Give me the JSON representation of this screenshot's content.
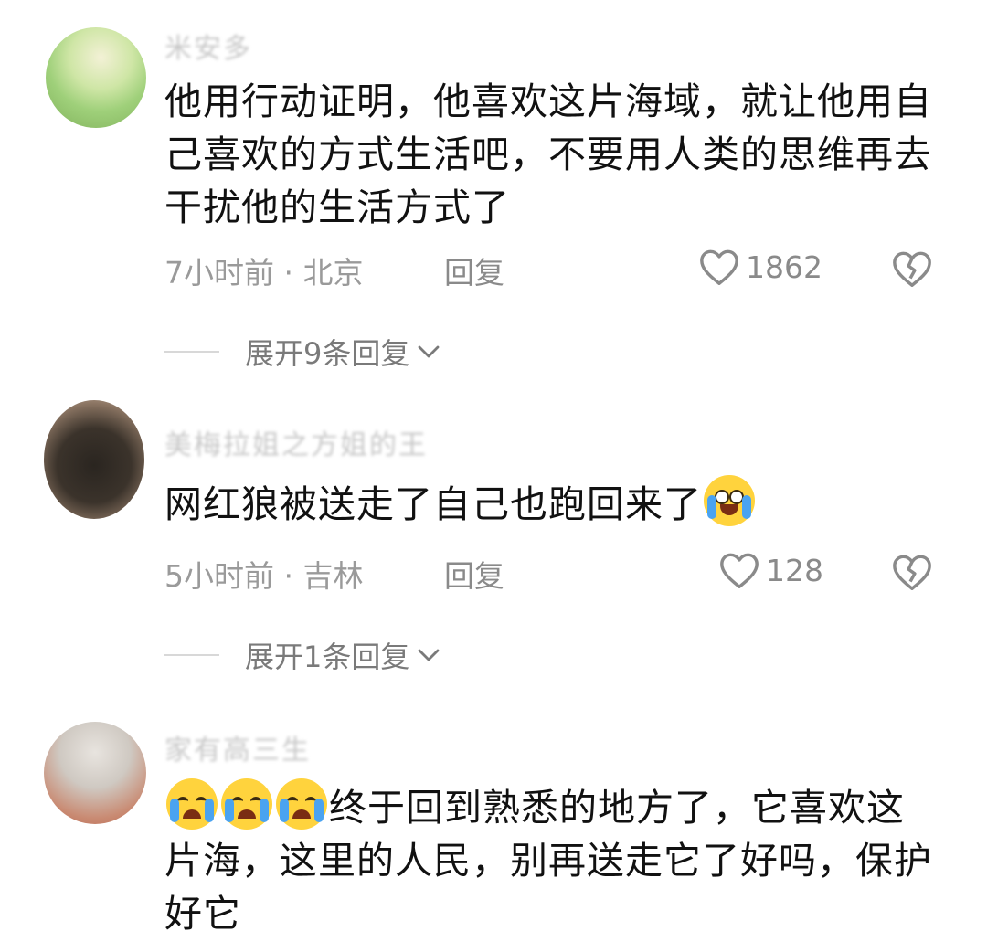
{
  "comments": [
    {
      "username": "米安多",
      "text": "他用行动证明，他喜欢这片海域，就让他用自己喜欢的方式生活吧，不要用人类的思维再去干扰他的生活方式了",
      "time": "7小时前 · 北京",
      "reply_label": "回复",
      "likes": "1862",
      "expand_label": "展开9条回复"
    },
    {
      "username": "美梅拉姐之方姐的王",
      "text": "网红狼被送走了自己也跑回来了",
      "time": "5小时前 · 吉林",
      "reply_label": "回复",
      "likes": "128",
      "expand_label": "展开1条回复"
    },
    {
      "username": "家有高三生",
      "text": "终于回到熟悉的地方了，它喜欢这片海，这里的人民，别再送走它了好吗，保护好它"
    }
  ],
  "icons": {
    "like": "heart-outline-icon",
    "dislike": "broken-heart-icon",
    "expand": "chevron-down-icon",
    "emoji_laugh_cry": "tears-of-joy-emoji",
    "emoji_cry": "loudly-crying-emoji"
  },
  "colors": {
    "text": "#111111",
    "meta": "#9a9a9a",
    "username": "#c7c7c7"
  }
}
